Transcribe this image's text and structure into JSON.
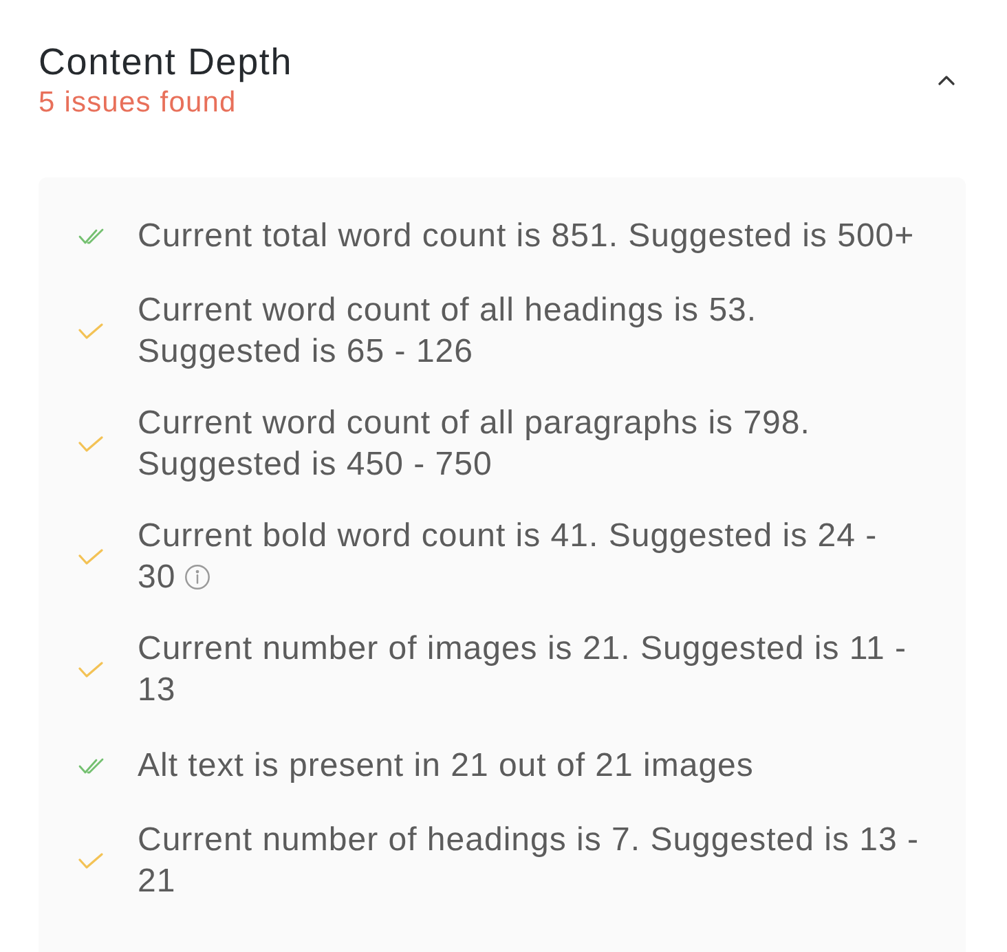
{
  "section": {
    "title": "Content Depth",
    "issues": "5 issues found",
    "expanded": true
  },
  "checks": [
    {
      "kind": "pass",
      "text": "Current total word count is 851. Suggested is 500+",
      "info": false
    },
    {
      "kind": "warning",
      "text": "Current word count of all headings is 53. Suggested is 65 - 126",
      "info": false
    },
    {
      "kind": "warning",
      "text": "Current word count of all paragraphs is 798. Suggested is 450 - 750",
      "info": false
    },
    {
      "kind": "warning",
      "text": "Current bold word count is 41. Suggested is 24 - 30",
      "info": true
    },
    {
      "kind": "warning",
      "text": "Current number of images is 21. Suggested is 11 - 13",
      "info": false
    },
    {
      "kind": "pass",
      "text": "Alt text is present in 21 out of 21 images",
      "info": false
    },
    {
      "kind": "warning",
      "text": "Current number of headings is 7. Suggested is 13 - 21",
      "info": false
    }
  ]
}
